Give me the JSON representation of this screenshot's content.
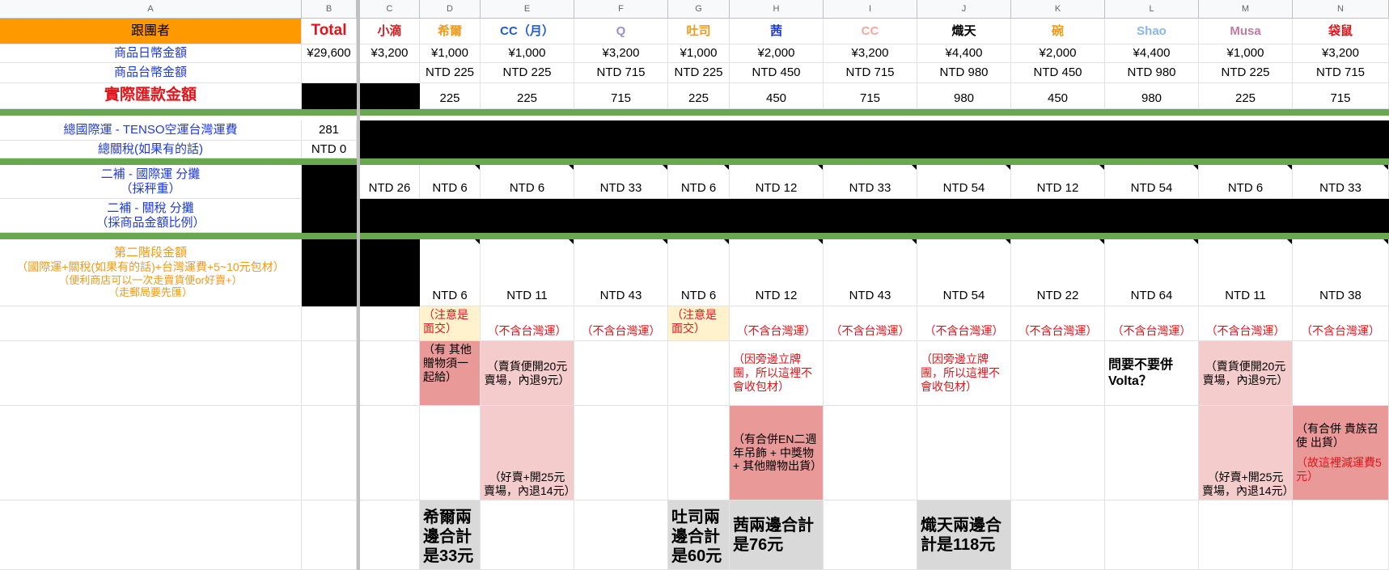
{
  "col_letters": [
    "A",
    "B",
    "C",
    "D",
    "E",
    "F",
    "G",
    "H",
    "I",
    "J",
    "K",
    "L",
    "M",
    "N"
  ],
  "header_row": {
    "label": "跟團者",
    "total": "Total",
    "names": [
      "小滴",
      "希爾",
      "CC（月）",
      "Q",
      "吐司",
      "茜",
      "CC",
      "熾天",
      "碗",
      "Shao",
      "Musa",
      "袋鼠"
    ]
  },
  "name_colors": [
    "#e0141a",
    "#f09a18",
    "#1f5bd9",
    "#9b8fce",
    "#f09a18",
    "#1f3ad9",
    "#f4a8a0",
    "#000000",
    "#f09a18",
    "#8ab6e8",
    "#c27ba0",
    "#e0141a"
  ],
  "jpy_row": {
    "label": "商品日幣金額",
    "total": "¥29,600",
    "values": [
      "¥3,200",
      "¥1,000",
      "¥1,000",
      "¥3,200",
      "¥1,000",
      "¥2,000",
      "¥3,200",
      "¥4,400",
      "¥2,000",
      "¥4,400",
      "¥1,000",
      "¥3,200"
    ]
  },
  "twd_row": {
    "label": "商品台幣金額",
    "values": [
      "",
      "NTD 225",
      "NTD 225",
      "NTD 715",
      "NTD 225",
      "NTD 450",
      "NTD 715",
      "NTD 980",
      "NTD 450",
      "NTD 980",
      "NTD 225",
      "NTD 715"
    ]
  },
  "remit_row": {
    "label": "實際匯款金額",
    "values": [
      "",
      "225",
      "225",
      "715",
      "225",
      "450",
      "715",
      "980",
      "450",
      "980",
      "225",
      "715"
    ]
  },
  "intl_shipping": {
    "label": "總國際運 - TENSO空運台灣運費",
    "value": "281"
  },
  "total_tax": {
    "label": "總關稅(如果有的話)",
    "value": "NTD 0"
  },
  "supp_shipping": {
    "label_line1": "二補 - 國際運 分攤",
    "label_line2": "（採秤重）",
    "values": [
      "NTD 26",
      "NTD 6",
      "NTD 6",
      "NTD 33",
      "NTD 6",
      "NTD 12",
      "NTD 33",
      "NTD 54",
      "NTD 12",
      "NTD 54",
      "NTD 6",
      "NTD 33"
    ]
  },
  "supp_tax": {
    "label_line1": "二補 - 關稅 分攤",
    "label_line2": "（採商品金額比例）"
  },
  "stage2": {
    "label_line1": "第二階段金額",
    "label_line2": "（國際運+關稅(如果有的話)+台灣運費+5~10元包材）",
    "label_line3": "（便利商店可以一次走賣貨便or好賣+）",
    "label_line4": "（走郵局要先匯）",
    "values": [
      "",
      "NTD 6",
      "NTD 11",
      "NTD 43",
      "NTD 6",
      "NTD 12",
      "NTD 43",
      "NTD 54",
      "NTD 22",
      "NTD 64",
      "NTD 11",
      "NTD 38"
    ]
  },
  "note_row1": {
    "values": [
      "",
      "（注意是面交）",
      "（不含台灣運）",
      "（不含台灣運）",
      "（注意是面交）",
      "（不含台灣運）",
      "（不含台灣運）",
      "（不含台灣運）",
      "（不含台灣運）",
      "（不含台灣運）",
      "（不含台灣運）",
      "（不含台灣運）"
    ]
  },
  "note_row2": {
    "xier": "（有 其他贈物須一起給）",
    "cc_month": "（賣貨便開20元賣場，內退9元）",
    "qian": "（因旁邊立牌團，所以這裡不會收包材）",
    "chitian": "（因旁邊立牌團，所以這裡不會收包材）",
    "shao": "問要不要併Volta？",
    "musa": "（賣貨便開20元賣場，內退9元）"
  },
  "note_row3": {
    "cc_month": "（好賣+開25元賣場，內退14元）",
    "qian": "（有合併EN二週年吊飾 + 中獎物 + 其他贈物出貨）",
    "musa": "（好賣+開25元賣場，內退14元）",
    "daishu_a": "（有合併 貴族召使 出貨）",
    "daishu_b": "（故這裡減運費5元）"
  },
  "note_row4": {
    "xier": "希爾兩邊合計是33元",
    "tusi": "吐司兩邊合計是60元",
    "qian": "茜兩邊合計是76元",
    "chitian": "熾天兩邊合計是118元"
  }
}
